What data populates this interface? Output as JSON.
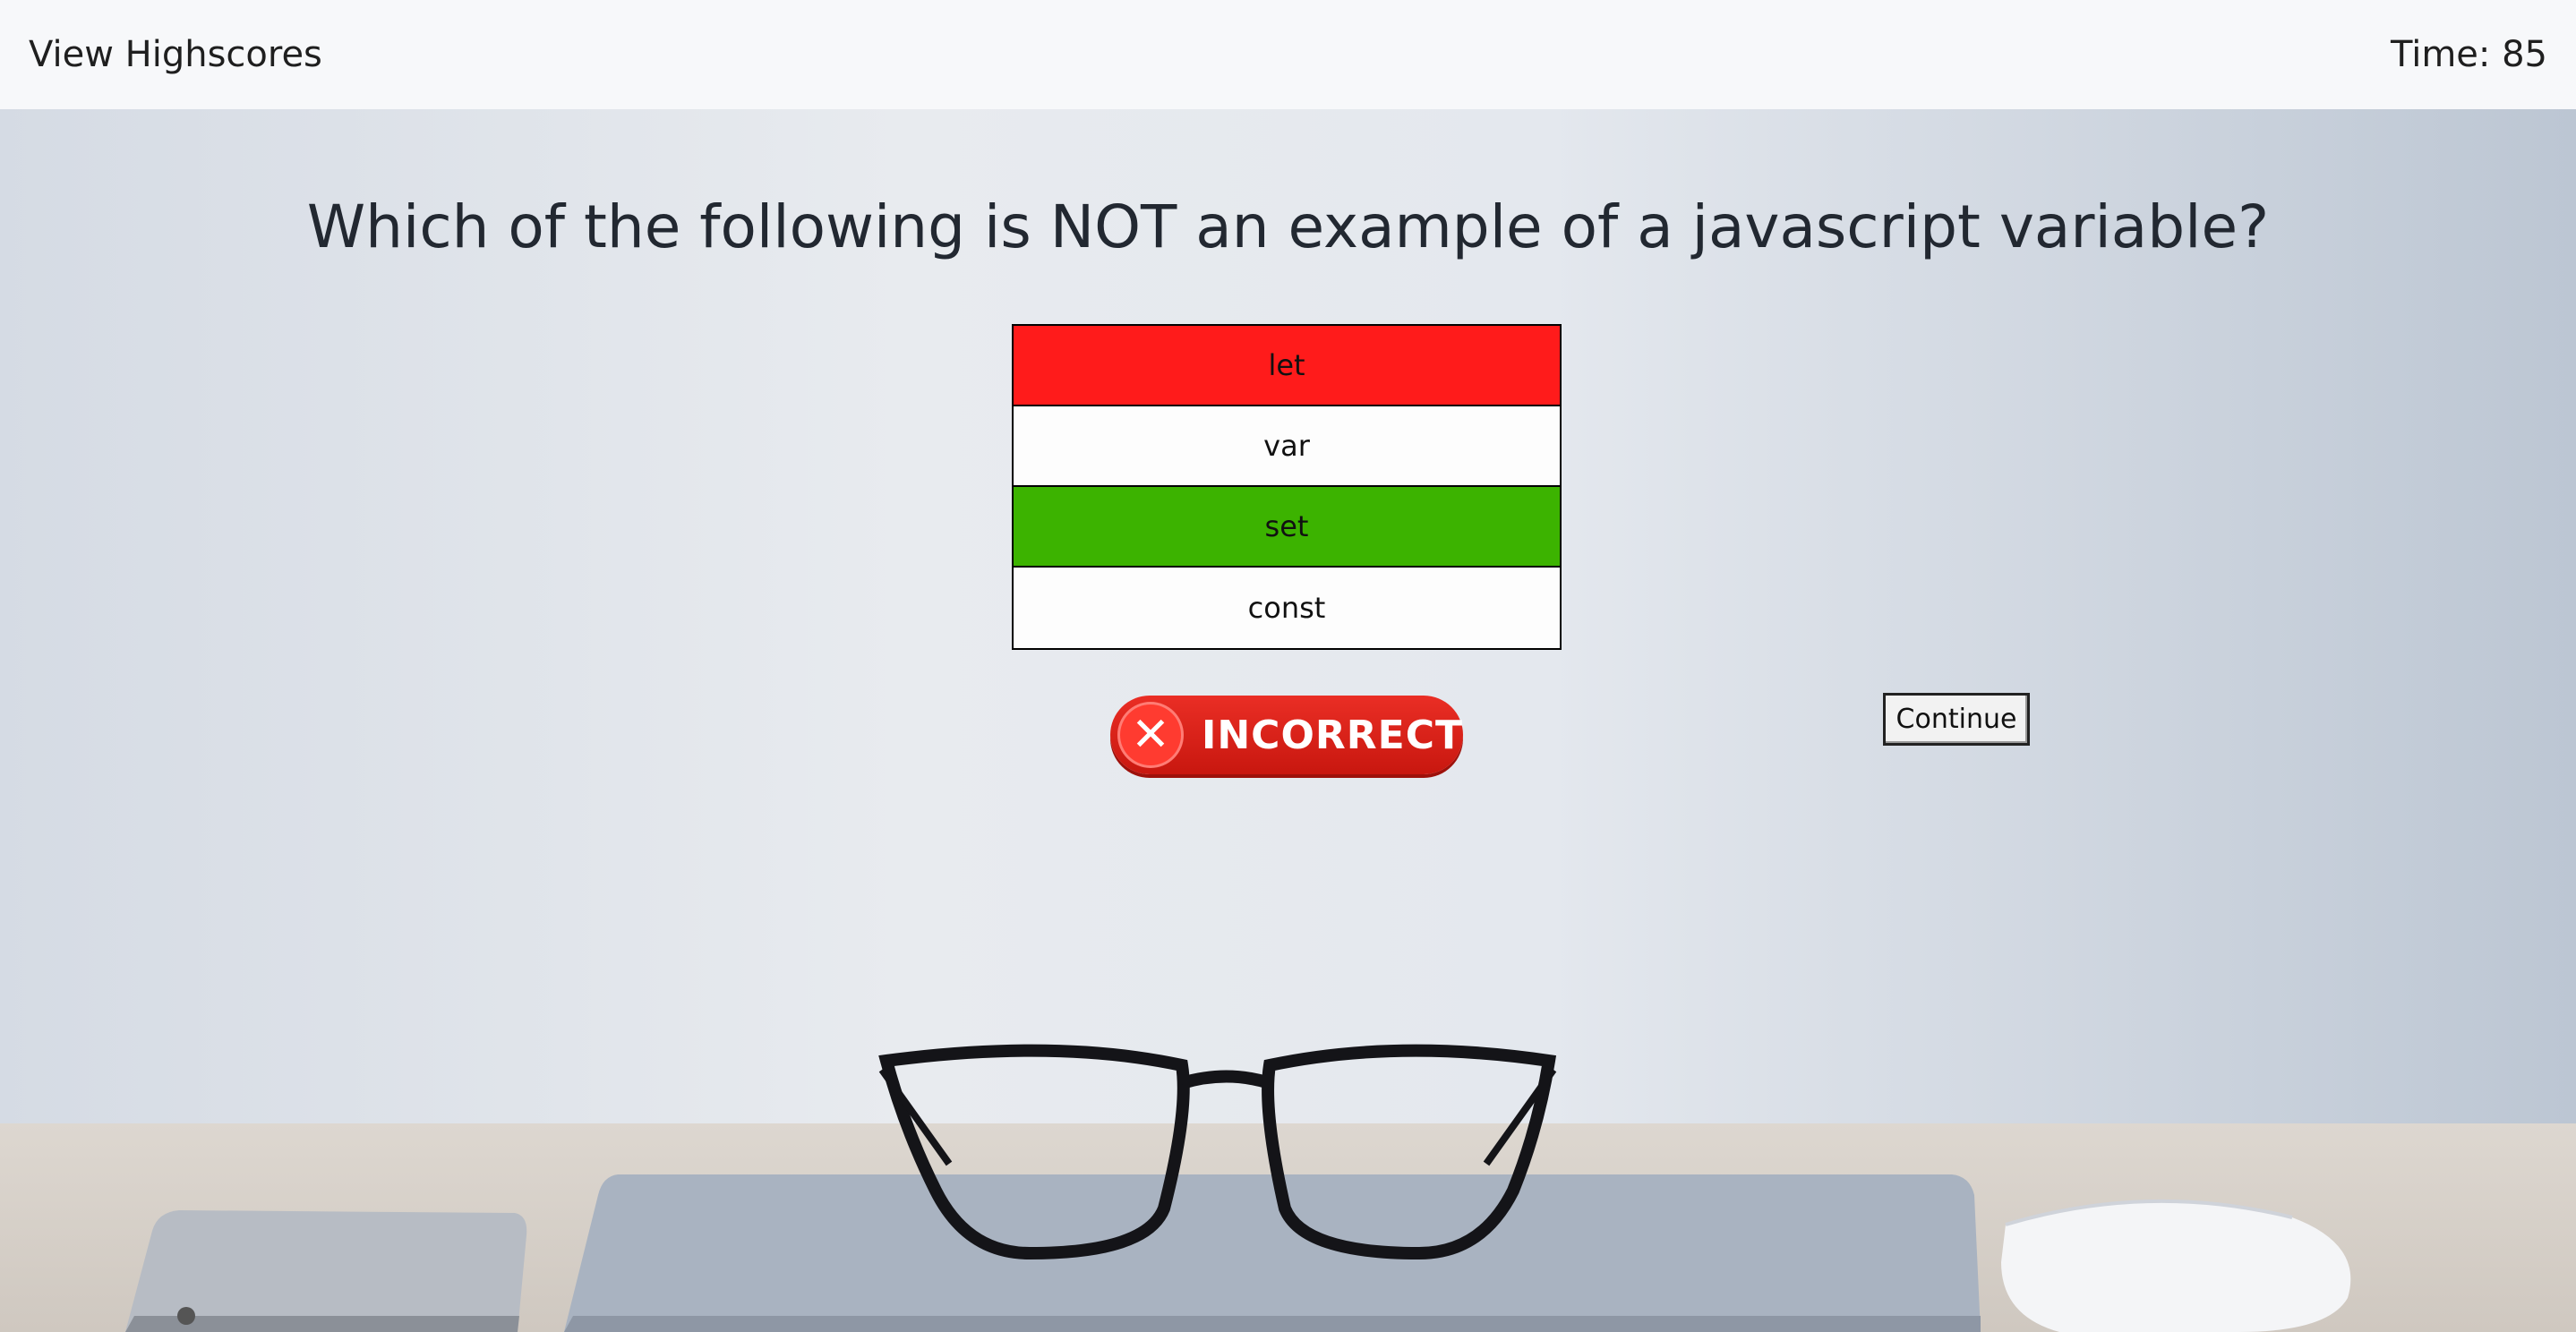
{
  "header": {
    "highscores_link": "View Highscores",
    "timer": "Time: 85"
  },
  "question": {
    "text": "Which of the following is NOT an example of a javascript variable?"
  },
  "answers": [
    {
      "label": "let",
      "state": "incorrect-selected",
      "color": "#ff1b1b"
    },
    {
      "label": "var",
      "state": "neutral",
      "color": "#fdfdfd"
    },
    {
      "label": "set",
      "state": "correct",
      "color": "#3cb300"
    },
    {
      "label": "const",
      "state": "neutral",
      "color": "#fdfdfd"
    }
  ],
  "feedback": {
    "badge_text": "INCORRECT",
    "icon": "x-circle-icon",
    "color": "#e02a21"
  },
  "continue_button": {
    "label": "Continue"
  }
}
